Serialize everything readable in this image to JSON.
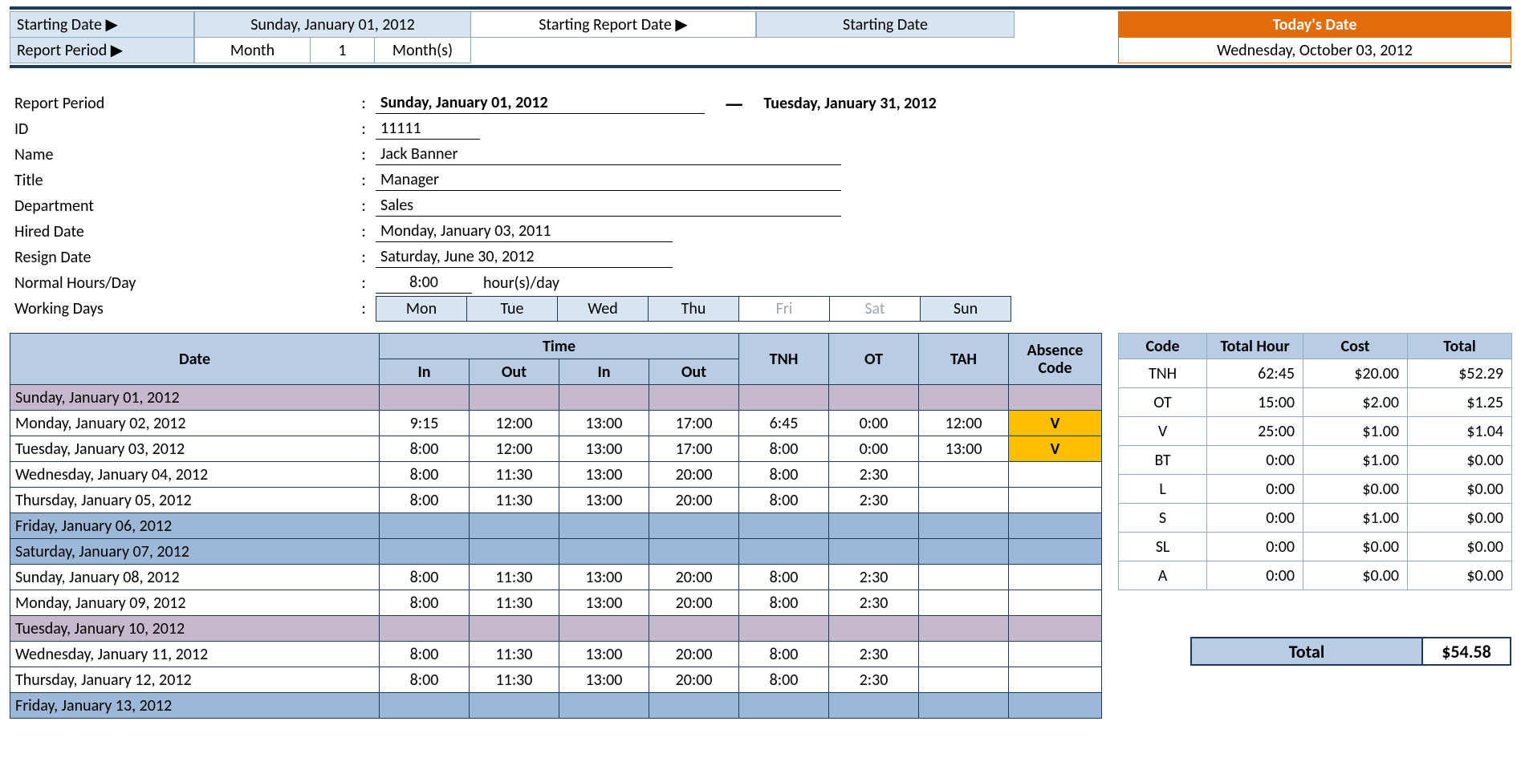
{
  "header": {
    "starting_date_label": "Starting Date ▶",
    "starting_date_value": "Sunday, January 01, 2012",
    "starting_report_label": "Starting Report Date ▶",
    "starting_report_value": "Starting Date",
    "report_period_label": "Report Period ▶",
    "report_period_unit": "Month",
    "report_period_count": "1",
    "report_period_suffix": "Month(s)",
    "todays_date_label": "Today's Date",
    "todays_date_value": "Wednesday, October 03, 2012"
  },
  "info": {
    "report_period_label": "Report Period",
    "report_period_start": "Sunday, January 01, 2012",
    "report_period_end": "Tuesday, January 31, 2012",
    "id_label": "ID",
    "id_value": "11111",
    "name_label": "Name",
    "name_value": "Jack Banner",
    "title_label": "Title",
    "title_value": "Manager",
    "department_label": "Department",
    "department_value": "Sales",
    "hired_label": "Hired Date",
    "hired_value": "Monday, January 03, 2011",
    "resign_label": "Resign Date",
    "resign_value": "Saturday, June 30, 2012",
    "normal_hours_label": "Normal Hours/Day",
    "normal_hours_value": "8:00",
    "normal_hours_suffix": "hour(s)/day",
    "working_days_label": "Working Days",
    "days": [
      "Mon",
      "Tue",
      "Wed",
      "Thu",
      "Fri",
      "Sat",
      "Sun"
    ],
    "off_days": [
      "Fri",
      "Sat"
    ]
  },
  "table": {
    "headers": {
      "date": "Date",
      "time": "Time",
      "in": "In",
      "out": "Out",
      "tnh": "TNH",
      "ot": "OT",
      "tah": "TAH",
      "absence": "Absence Code"
    },
    "rows": [
      {
        "date": "Sunday, January 01, 2012",
        "style": "purple"
      },
      {
        "date": "Monday, January 02, 2012",
        "in1": "9:15",
        "out1": "12:00",
        "in2": "13:00",
        "out2": "17:00",
        "tnh": "6:45",
        "ot": "0:00",
        "tah": "12:00",
        "abs": "V"
      },
      {
        "date": "Tuesday, January 03, 2012",
        "in1": "8:00",
        "out1": "12:00",
        "in2": "13:00",
        "out2": "17:00",
        "tnh": "8:00",
        "ot": "0:00",
        "tah": "13:00",
        "abs": "V"
      },
      {
        "date": "Wednesday, January 04, 2012",
        "in1": "8:00",
        "out1": "11:30",
        "in2": "13:00",
        "out2": "20:00",
        "tnh": "8:00",
        "ot": "2:30"
      },
      {
        "date": "Thursday, January 05, 2012",
        "in1": "8:00",
        "out1": "11:30",
        "in2": "13:00",
        "out2": "20:00",
        "tnh": "8:00",
        "ot": "2:30"
      },
      {
        "date": "Friday, January 06, 2012",
        "style": "weekend"
      },
      {
        "date": "Saturday, January 07, 2012",
        "style": "weekend"
      },
      {
        "date": "Sunday, January 08, 2012",
        "in1": "8:00",
        "out1": "11:30",
        "in2": "13:00",
        "out2": "20:00",
        "tnh": "8:00",
        "ot": "2:30"
      },
      {
        "date": "Monday, January 09, 2012",
        "in1": "8:00",
        "out1": "11:30",
        "in2": "13:00",
        "out2": "20:00",
        "tnh": "8:00",
        "ot": "2:30"
      },
      {
        "date": "Tuesday, January 10, 2012",
        "style": "purple"
      },
      {
        "date": "Wednesday, January 11, 2012",
        "in1": "8:00",
        "out1": "11:30",
        "in2": "13:00",
        "out2": "20:00",
        "tnh": "8:00",
        "ot": "2:30"
      },
      {
        "date": "Thursday, January 12, 2012",
        "in1": "8:00",
        "out1": "11:30",
        "in2": "13:00",
        "out2": "20:00",
        "tnh": "8:00",
        "ot": "2:30"
      },
      {
        "date": "Friday, January 13, 2012",
        "style": "weekend"
      }
    ]
  },
  "summary": {
    "headers": {
      "code": "Code",
      "total_hour": "Total Hour",
      "cost": "Cost",
      "total": "Total"
    },
    "rows": [
      {
        "code": "TNH",
        "hour": "62:45",
        "cost": "$20.00",
        "total": "$52.29"
      },
      {
        "code": "OT",
        "hour": "15:00",
        "cost": "$2.00",
        "total": "$1.25"
      },
      {
        "code": "V",
        "hour": "25:00",
        "cost": "$1.00",
        "total": "$1.04"
      },
      {
        "code": "BT",
        "hour": "0:00",
        "cost": "$1.00",
        "total": "$0.00"
      },
      {
        "code": "L",
        "hour": "0:00",
        "cost": "$0.00",
        "total": "$0.00"
      },
      {
        "code": "S",
        "hour": "0:00",
        "cost": "$1.00",
        "total": "$0.00"
      },
      {
        "code": "SL",
        "hour": "0:00",
        "cost": "$0.00",
        "total": "$0.00"
      },
      {
        "code": "A",
        "hour": "0:00",
        "cost": "$0.00",
        "total": "$0.00"
      }
    ],
    "grand_label": "Total",
    "grand_value": "$54.58"
  }
}
